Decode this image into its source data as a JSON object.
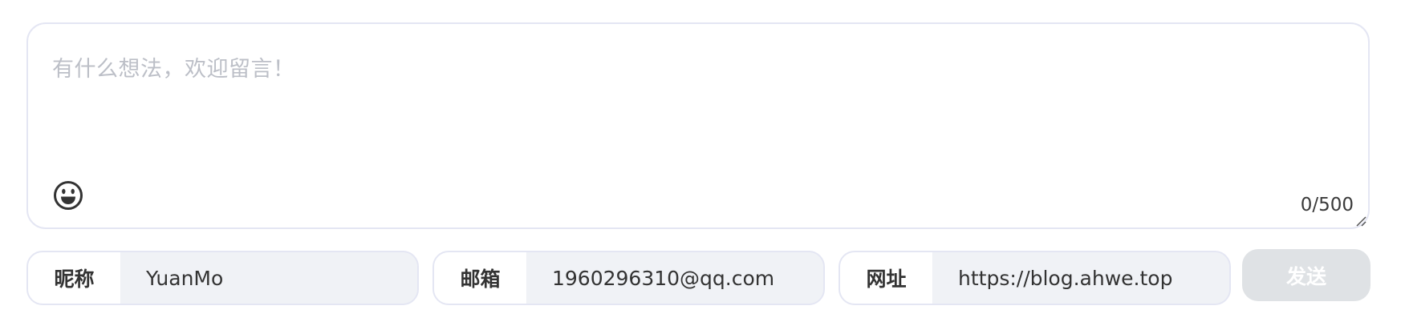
{
  "comment": {
    "placeholder": "有什么想法，欢迎留言！",
    "counter": "0/500",
    "emoji_icon": "smile-emoji-icon"
  },
  "fields": [
    {
      "label": "昵称",
      "value": "YuanMo"
    },
    {
      "label": "邮箱",
      "value": "1960296310@qq.com"
    },
    {
      "label": "网址",
      "value": "https://blog.ahwe.top"
    }
  ],
  "send_button": {
    "label": "发送",
    "state": "disabled"
  },
  "colors": {
    "border": "#e4e6f3",
    "input_background": "#f0f2f6",
    "placeholder_text": "#bcbfc7",
    "send_button_disabled": "#dfe2e5"
  }
}
